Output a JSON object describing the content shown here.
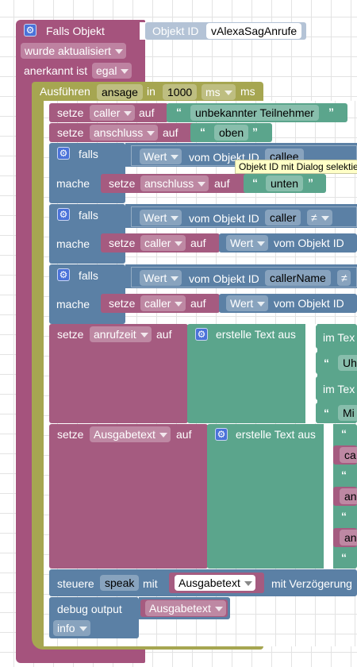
{
  "trigger": {
    "title": "Falls Objekt",
    "oid_label": "Objekt ID",
    "oid_value": "vAlexaSagAnrufe",
    "event": "wurde aktualisiert",
    "ack_label": "anerkannt ist",
    "ack_value": "egal"
  },
  "timeout": {
    "label": "Ausführen",
    "name": "ansage",
    "in_label": "in",
    "value": "1000",
    "unit": "ms",
    "unit_suffix": "ms"
  },
  "kw": {
    "set": "setze",
    "to": "auf",
    "if": "falls",
    "do": "mache",
    "value": "Wert",
    "from_object": "vom Objekt ID",
    "create_text": "erstelle Text aus",
    "in_text": "im Tex"
  },
  "ops": {
    "neq": "≠"
  },
  "vars": {
    "caller": "caller",
    "anschluss": "anschluss",
    "anrufzeit": "anrufzeit",
    "ausgabetext": "Ausgabetext"
  },
  "strings": {
    "unknown": "unbekannter Teilnehmer",
    "oben": "oben",
    "unten": "unten",
    "uh": "Uh",
    "mi": "Mi"
  },
  "object_ids": {
    "callee": "callee",
    "caller": "caller",
    "callerName": "callerName"
  },
  "tooltip": "Objekt ID mit Dialog selektie",
  "partial": {
    "ca": "ca",
    "an1": "an",
    "an2": "an"
  },
  "control": {
    "label": "steuere",
    "target": "speak",
    "with": "mit",
    "delay": "mit Verzögerung"
  },
  "debug": {
    "label": "debug output",
    "level": "info"
  },
  "colors": {
    "event": "#a5537d",
    "oid": "#b4c3d6",
    "timeout": "#a6a651",
    "set": "#a55b80",
    "text": "#5ba58c",
    "logic": "#5b80a5",
    "tooltip": "#ffffc7"
  }
}
